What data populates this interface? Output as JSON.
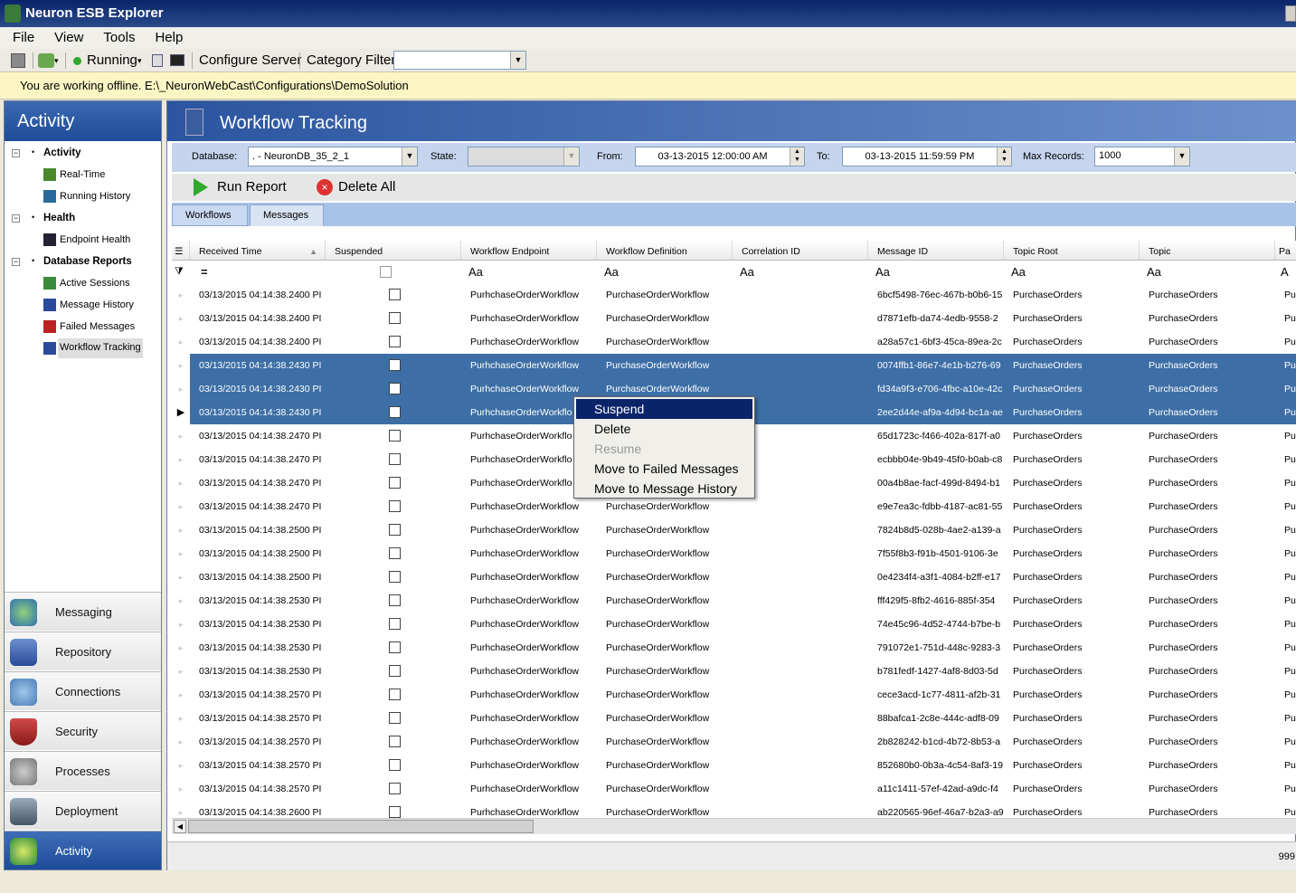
{
  "window": {
    "title": "Neuron ESB Explorer"
  },
  "menu": [
    "File",
    "View",
    "Tools",
    "Help"
  ],
  "toolbar": {
    "status": "Running",
    "configure": "Configure Server",
    "category_filter": "Category Filter",
    "category_value": ""
  },
  "offline_message": "You are working offline. E:\\_NeuronWebCast\\Configurations\\DemoSolution",
  "left_panel": {
    "header": "Activity",
    "groups": [
      {
        "label": "Activity",
        "items": [
          "Real-Time",
          "Running History"
        ]
      },
      {
        "label": "Health",
        "items": [
          "Endpoint Health"
        ]
      },
      {
        "label": "Database Reports",
        "items": [
          "Active Sessions",
          "Message History",
          "Failed Messages",
          "Workflow Tracking"
        ]
      }
    ],
    "nav": [
      "Messaging",
      "Repository",
      "Connections",
      "Security",
      "Processes",
      "Deployment",
      "Activity"
    ]
  },
  "main": {
    "title": "Workflow Tracking",
    "filters": {
      "database_label": "Database:",
      "database_value": ". - NeuronDB_35_2_1",
      "state_label": "State:",
      "state_value": "",
      "from_label": "From:",
      "from_value": "03-13-2015 12:00:00 AM",
      "to_label": "To:",
      "to_value": "03-13-2015 11:59:59 PM",
      "max_label": "Max Records:",
      "max_value": "1000"
    },
    "actions": {
      "run": "Run Report",
      "delete_all": "Delete All"
    },
    "tabs": [
      "Workflows",
      "Messages"
    ],
    "columns": [
      "Received Time",
      "Suspended",
      "Workflow Endpoint",
      "Workflow Definition",
      "Correlation ID",
      "Message ID",
      "Topic Root",
      "Topic",
      "Pa"
    ],
    "filter_row": {
      "eq": "=",
      "aa": "Aa",
      "last": "A"
    },
    "rows": [
      {
        "time": "03/13/2015 04:14:38.2400 PI",
        "endpoint": "PurhchaseOrderWorkflow",
        "def": "PurchaseOrderWorkflow",
        "msgid": "6bcf5498-76ec-467b-b0b6-15",
        "root": "PurchaseOrders",
        "topic": "PurchaseOrders",
        "pa": "Pu"
      },
      {
        "time": "03/13/2015 04:14:38.2400 PI",
        "endpoint": "PurhchaseOrderWorkflow",
        "def": "PurchaseOrderWorkflow",
        "msgid": "d7871efb-da74-4edb-9558-2",
        "root": "PurchaseOrders",
        "topic": "PurchaseOrders",
        "pa": "Pu"
      },
      {
        "time": "03/13/2015 04:14:38.2400 PI",
        "endpoint": "PurhchaseOrderWorkflow",
        "def": "PurchaseOrderWorkflow",
        "msgid": "a28a57c1-6bf3-45ca-89ea-2c",
        "root": "PurchaseOrders",
        "topic": "PurchaseOrders",
        "pa": "Pu"
      },
      {
        "time": "03/13/2015 04:14:38.2430 PI",
        "endpoint": "PurhchaseOrderWorkflow",
        "def": "PurchaseOrderWorkflow",
        "msgid": "0074ffb1-86e7-4e1b-b276-69",
        "root": "PurchaseOrders",
        "topic": "PurchaseOrders",
        "pa": "Pu",
        "selected": true
      },
      {
        "time": "03/13/2015 04:14:38.2430 PI",
        "endpoint": "PurhchaseOrderWorkflow",
        "def": "PurchaseOrderWorkflow",
        "msgid": "fd34a9f3-e706-4fbc-a10e-42c",
        "root": "PurchaseOrders",
        "topic": "PurchaseOrders",
        "pa": "Pu",
        "selected": true
      },
      {
        "time": "03/13/2015 04:14:38.2430 PI",
        "endpoint": "PurhchaseOrderWorkflo",
        "def": "",
        "msgid": "2ee2d44e-af9a-4d94-bc1a-ae",
        "root": "PurchaseOrders",
        "topic": "PurchaseOrders",
        "pa": "Pu",
        "selected": true,
        "current": true
      },
      {
        "time": "03/13/2015 04:14:38.2470 PI",
        "endpoint": "PurhchaseOrderWorkflo",
        "def": "",
        "msgid": "65d1723c-f466-402a-817f-a0",
        "root": "PurchaseOrders",
        "topic": "PurchaseOrders",
        "pa": "Pu"
      },
      {
        "time": "03/13/2015 04:14:38.2470 PI",
        "endpoint": "PurhchaseOrderWorkflo",
        "def": "",
        "msgid": "ecbbb04e-9b49-45f0-b0ab-c8",
        "root": "PurchaseOrders",
        "topic": "PurchaseOrders",
        "pa": "Pu"
      },
      {
        "time": "03/13/2015 04:14:38.2470 PI",
        "endpoint": "PurhchaseOrderWorkflo",
        "def": "",
        "msgid": "00a4b8ae-facf-499d-8494-b1",
        "root": "PurchaseOrders",
        "topic": "PurchaseOrders",
        "pa": "Pu"
      },
      {
        "time": "03/13/2015 04:14:38.2470 PI",
        "endpoint": "PurhchaseOrderWorkflow",
        "def": "PurchaseOrderWorkflow",
        "msgid": "e9e7ea3c-fdbb-4187-ac81-55",
        "root": "PurchaseOrders",
        "topic": "PurchaseOrders",
        "pa": "Pu"
      },
      {
        "time": "03/13/2015 04:14:38.2500 PI",
        "endpoint": "PurhchaseOrderWorkflow",
        "def": "PurchaseOrderWorkflow",
        "msgid": "7824b8d5-028b-4ae2-a139-a",
        "root": "PurchaseOrders",
        "topic": "PurchaseOrders",
        "pa": "Pu"
      },
      {
        "time": "03/13/2015 04:14:38.2500 PI",
        "endpoint": "PurhchaseOrderWorkflow",
        "def": "PurchaseOrderWorkflow",
        "msgid": "7f55f8b3-f91b-4501-9106-3e",
        "root": "PurchaseOrders",
        "topic": "PurchaseOrders",
        "pa": "Pu"
      },
      {
        "time": "03/13/2015 04:14:38.2500 PI",
        "endpoint": "PurhchaseOrderWorkflow",
        "def": "PurchaseOrderWorkflow",
        "msgid": "0e4234f4-a3f1-4084-b2ff-e17",
        "root": "PurchaseOrders",
        "topic": "PurchaseOrders",
        "pa": "Pu"
      },
      {
        "time": "03/13/2015 04:14:38.2530 PI",
        "endpoint": "PurhchaseOrderWorkflow",
        "def": "PurchaseOrderWorkflow",
        "msgid": "fff429f5-8fb2-4616-885f-354",
        "root": "PurchaseOrders",
        "topic": "PurchaseOrders",
        "pa": "Pu"
      },
      {
        "time": "03/13/2015 04:14:38.2530 PI",
        "endpoint": "PurhchaseOrderWorkflow",
        "def": "PurchaseOrderWorkflow",
        "msgid": "74e45c96-4d52-4744-b7be-b",
        "root": "PurchaseOrders",
        "topic": "PurchaseOrders",
        "pa": "Pu"
      },
      {
        "time": "03/13/2015 04:14:38.2530 PI",
        "endpoint": "PurhchaseOrderWorkflow",
        "def": "PurchaseOrderWorkflow",
        "msgid": "791072e1-751d-448c-9283-3",
        "root": "PurchaseOrders",
        "topic": "PurchaseOrders",
        "pa": "Pu"
      },
      {
        "time": "03/13/2015 04:14:38.2530 PI",
        "endpoint": "PurhchaseOrderWorkflow",
        "def": "PurchaseOrderWorkflow",
        "msgid": "b781fedf-1427-4af8-8d03-5d",
        "root": "PurchaseOrders",
        "topic": "PurchaseOrders",
        "pa": "Pu"
      },
      {
        "time": "03/13/2015 04:14:38.2570 PI",
        "endpoint": "PurhchaseOrderWorkflow",
        "def": "PurchaseOrderWorkflow",
        "msgid": "cece3acd-1c77-4811-af2b-31",
        "root": "PurchaseOrders",
        "topic": "PurchaseOrders",
        "pa": "Pu"
      },
      {
        "time": "03/13/2015 04:14:38.2570 PI",
        "endpoint": "PurhchaseOrderWorkflow",
        "def": "PurchaseOrderWorkflow",
        "msgid": "88bafca1-2c8e-444c-adf8-09",
        "root": "PurchaseOrders",
        "topic": "PurchaseOrders",
        "pa": "Pu"
      },
      {
        "time": "03/13/2015 04:14:38.2570 PI",
        "endpoint": "PurhchaseOrderWorkflow",
        "def": "PurchaseOrderWorkflow",
        "msgid": "2b828242-b1cd-4b72-8b53-a",
        "root": "PurchaseOrders",
        "topic": "PurchaseOrders",
        "pa": "Pu"
      },
      {
        "time": "03/13/2015 04:14:38.2570 PI",
        "endpoint": "PurhchaseOrderWorkflow",
        "def": "PurchaseOrderWorkflow",
        "msgid": "852680b0-0b3a-4c54-8af3-19",
        "root": "PurchaseOrders",
        "topic": "PurchaseOrders",
        "pa": "Pu"
      },
      {
        "time": "03/13/2015 04:14:38.2570 PI",
        "endpoint": "PurhchaseOrderWorkflow",
        "def": "PurchaseOrderWorkflow",
        "msgid": "a11c1411-57ef-42ad-a9dc-f4",
        "root": "PurchaseOrders",
        "topic": "PurchaseOrders",
        "pa": "Pu"
      },
      {
        "time": "03/13/2015 04:14:38.2600 PI",
        "endpoint": "PurhchaseOrderWorkflow",
        "def": "PurchaseOrderWorkflow",
        "msgid": "ab220565-96ef-46a7-b2a3-a9",
        "root": "PurchaseOrders",
        "topic": "PurchaseOrders",
        "pa": "Pu"
      }
    ],
    "status_right": "999"
  },
  "context_menu": {
    "items": [
      {
        "label": "Suspend",
        "state": "highlighted"
      },
      {
        "label": "Delete",
        "state": "normal"
      },
      {
        "label": "Resume",
        "state": "disabled"
      },
      {
        "label": "Move to Failed Messages",
        "state": "normal"
      },
      {
        "label": "Move to Message History",
        "state": "normal"
      }
    ]
  },
  "colors": {
    "selection": "#3d6fa6",
    "header_blue": "#2b55a0",
    "offline_bar": "#fbf6c4",
    "menu_highlight": "#0a246a"
  }
}
